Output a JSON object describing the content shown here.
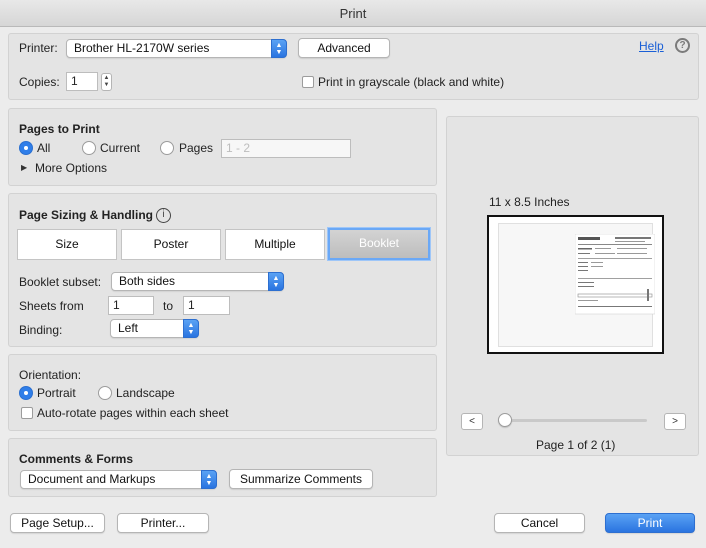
{
  "window": {
    "title": "Print"
  },
  "printer": {
    "label": "Printer:",
    "selected": "Brother HL-2170W series",
    "advanced_label": "Advanced",
    "help_label": "Help"
  },
  "copies": {
    "label": "Copies:",
    "value": "1",
    "grayscale_label": "Print in grayscale (black and white)",
    "grayscale_checked": false
  },
  "pages_to_print": {
    "heading": "Pages to Print",
    "options": [
      "All",
      "Current",
      "Pages"
    ],
    "selected": "All",
    "range_placeholder": "1 - 2",
    "more_options_label": "More Options"
  },
  "page_sizing": {
    "heading": "Page Sizing & Handling",
    "modes": [
      "Size",
      "Poster",
      "Multiple",
      "Booklet"
    ],
    "active_mode": "Booklet",
    "booklet_subset_label": "Booklet subset:",
    "booklet_subset": "Both sides",
    "sheets_from_label": "Sheets from",
    "sheets_from": "1",
    "to_label": "to",
    "sheets_to": "1",
    "binding_label": "Binding:",
    "binding": "Left"
  },
  "orientation": {
    "heading": "Orientation:",
    "options": [
      "Portrait",
      "Landscape"
    ],
    "selected": "Portrait",
    "auto_rotate_label": "Auto-rotate pages within each sheet"
  },
  "comments_forms": {
    "heading": "Comments & Forms",
    "selected": "Document and Markups",
    "summarize_label": "Summarize Comments"
  },
  "preview": {
    "paper_size": "11 x 8.5 Inches",
    "page_indicator": "Page 1 of 2 (1)",
    "prev_glyph": "<",
    "next_glyph": ">"
  },
  "footer": {
    "page_setup_label": "Page Setup...",
    "printer_label": "Printer...",
    "cancel_label": "Cancel",
    "print_label": "Print"
  },
  "colors": {
    "accent": "#2f7ee9",
    "link": "#1a5fd6",
    "panel": "#e4e4e4"
  }
}
